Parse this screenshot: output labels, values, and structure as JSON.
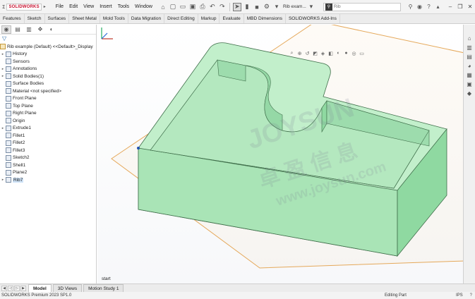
{
  "brand": {
    "prefix": "Ʃ",
    "name": "SOLIDWORKS"
  },
  "menus": [
    "File",
    "Edit",
    "View",
    "Insert",
    "Tools",
    "Window"
  ],
  "document": {
    "name": "Rib exam..."
  },
  "search": {
    "placeholder": "Rib"
  },
  "command_tabs": [
    "Features",
    "Sketch",
    "Surfaces",
    "Sheet Metal",
    "Mold Tools",
    "Data Migration",
    "Direct Editing",
    "Markup",
    "Evaluate",
    "MBD Dimensions",
    "SOLIDWORKS Add-Ins"
  ],
  "tree": {
    "root": "Rib example (Default) <<Default>_Display",
    "items": [
      {
        "label": "History",
        "icon": "history-icon",
        "expandable": true
      },
      {
        "label": "Sensors",
        "icon": "sensor-icon",
        "expandable": false
      },
      {
        "label": "Annotations",
        "icon": "annotation-icon",
        "expandable": true
      },
      {
        "label": "Solid Bodies(1)",
        "icon": "solid-bodies-icon",
        "expandable": true
      },
      {
        "label": "Surface Bodies",
        "icon": "surface-bodies-icon",
        "expandable": false
      },
      {
        "label": "Material <not specified>",
        "icon": "material-icon",
        "expandable": false
      },
      {
        "label": "Front Plane",
        "icon": "plane-icon",
        "expandable": false
      },
      {
        "label": "Top Plane",
        "icon": "plane-icon",
        "expandable": false
      },
      {
        "label": "Right Plane",
        "icon": "plane-icon",
        "expandable": false
      },
      {
        "label": "Origin",
        "icon": "origin-icon",
        "expandable": false
      },
      {
        "label": "Extrude1",
        "icon": "extrude-icon",
        "expandable": true
      },
      {
        "label": "Fillet1",
        "icon": "fillet-icon",
        "expandable": false
      },
      {
        "label": "Fillet2",
        "icon": "fillet-icon",
        "expandable": false
      },
      {
        "label": "Fillet3",
        "icon": "fillet-icon",
        "expandable": false
      },
      {
        "label": "Sketch2",
        "icon": "sketch-icon",
        "expandable": false
      },
      {
        "label": "Shell1",
        "icon": "shell-icon",
        "expandable": false
      },
      {
        "label": "Plane2",
        "icon": "plane-icon",
        "expandable": false
      },
      {
        "label": "Rib7",
        "icon": "rib-icon",
        "expandable": true,
        "selected": true
      }
    ]
  },
  "graphics": {
    "sketch_label": "start",
    "watermark": {
      "line1": "JOYSUN",
      "line2": "卓 盈 信 息",
      "line3": "www.joysun.com"
    },
    "colors": {
      "part_face": "#a9e4b6",
      "part_top": "#c2efcb",
      "part_wall": "#8fd9a1",
      "plane_edge": "#e5a85a",
      "edge": "#3f6e4a"
    }
  },
  "bottom_tabs": [
    "Model",
    "3D Views",
    "Motion Study 1"
  ],
  "status": {
    "product": "SOLIDWORKS Premium 2023 SP1.0",
    "mode": "Editing Part",
    "units": "IPS",
    "help": "?"
  }
}
